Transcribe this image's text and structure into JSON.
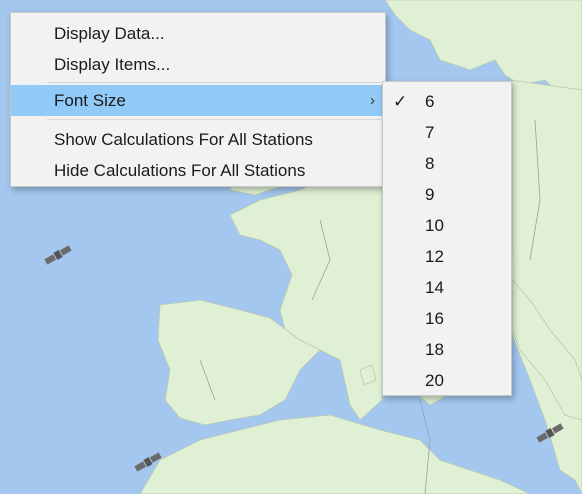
{
  "context_menu": {
    "items": [
      {
        "label": "Display Data...",
        "highlighted": false
      },
      {
        "label": "Display Items...",
        "highlighted": false
      },
      {
        "label": "Font Size",
        "highlighted": true,
        "has_submenu": true
      },
      {
        "label": "Show Calculations For All Stations",
        "highlighted": false
      },
      {
        "label": "Hide Calculations For All Stations",
        "highlighted": false
      }
    ],
    "submenu_arrow": "›"
  },
  "font_size_submenu": {
    "options": [
      "6",
      "7",
      "8",
      "9",
      "10",
      "12",
      "14",
      "16",
      "18",
      "20"
    ],
    "selected": "6",
    "check_mark": "✓"
  },
  "map": {
    "sea_color": "#a3c7ef",
    "land_color": "#dff0d4",
    "border_color": "#9aa0a6",
    "satellite_icon": "satellite-icon",
    "satellite_count": 3
  }
}
